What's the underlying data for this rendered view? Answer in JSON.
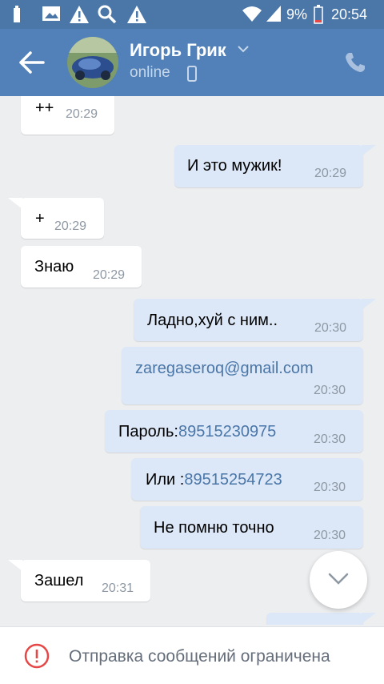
{
  "status_bar": {
    "battery": "9%",
    "time": "20:54"
  },
  "header": {
    "name": "Игорь Грик",
    "status": "online"
  },
  "messages": [
    {
      "text": "++",
      "time": "20:29"
    },
    {
      "text": "И это мужик!",
      "time": "20:29"
    },
    {
      "text": "+",
      "time": "20:29"
    },
    {
      "text": "Знаю",
      "time": "20:29"
    },
    {
      "text": "Ладно,хуй с ним..",
      "time": "20:30"
    },
    {
      "text": "zaregaseroq@gmail.com",
      "time": "20:30"
    },
    {
      "prefix": "Пароль:",
      "link": "89515230975",
      "time": "20:30"
    },
    {
      "prefix": "Или :",
      "link": "89515254723",
      "time": "20:30"
    },
    {
      "text": "Не помню точно",
      "time": "20:30"
    },
    {
      "text": "Зашел",
      "time": "20:31"
    }
  ],
  "footer": {
    "text": "Отправка сообщений ограничена"
  },
  "colors": {
    "header": "#5181b8",
    "statusbar": "#4a76a8",
    "outgoing": "#dce8f7",
    "link": "#4a76a8",
    "warning": "#e64646"
  }
}
